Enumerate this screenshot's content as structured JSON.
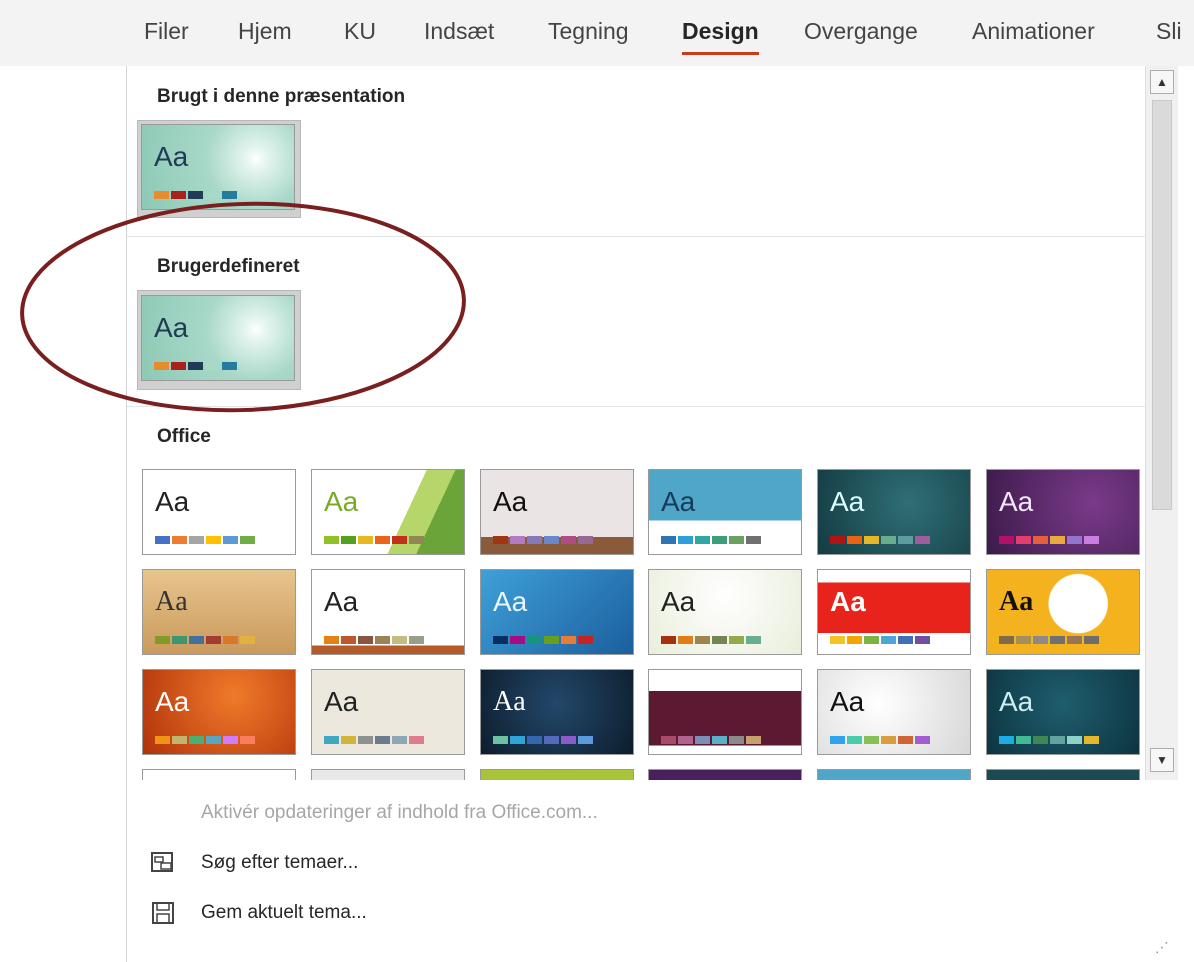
{
  "ribbon": {
    "tabs": [
      {
        "label": "Filer"
      },
      {
        "label": "Hjem"
      },
      {
        "label": "KU"
      },
      {
        "label": "Indsæt"
      },
      {
        "label": "Tegning"
      },
      {
        "label": "Design",
        "active": true
      },
      {
        "label": "Overgange"
      },
      {
        "label": "Animationer"
      },
      {
        "label": "Sli"
      }
    ]
  },
  "gallery": {
    "sections": {
      "used": {
        "title": "Brugt i denne præsentation"
      },
      "custom": {
        "title": "Brugerdefineret"
      },
      "office": {
        "title": "Office"
      }
    },
    "thumb_label": "Aa"
  },
  "menu": {
    "enable_updates": "Aktivér opdateringer af indhold fra Office.com...",
    "browse_themes": "Søg efter temaer...",
    "save_theme": "Gem aktuelt tema..."
  },
  "colors": {
    "accent_tab": "#c43e1c",
    "annotation": "#7a1f1f",
    "facet_bg": "#a8d8c8"
  },
  "icons": {
    "browse": "browse-themes-icon",
    "save": "save-icon",
    "scroll_up": "chevron-up-icon",
    "scroll_down": "chevron-down-icon"
  }
}
